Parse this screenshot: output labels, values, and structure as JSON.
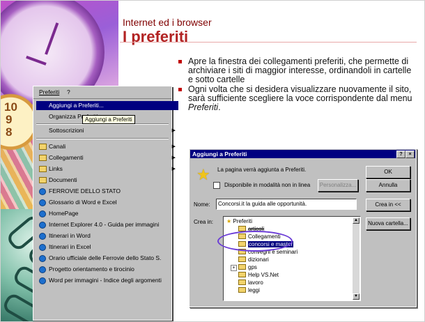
{
  "slide": {
    "subtitle": "Internet ed i browser",
    "title": "I preferiti",
    "bullets": [
      "Apre  la finestra dei collegamenti preferiti, che permette di archiviare i siti di maggior interesse, ordinandoli in cartelle e sotto cartelle",
      "Ogni volta che si desidera visualizzare nuovamente il sito, sarà sufficiente scegliere la voce corrispondente dal menu Preferiti."
    ],
    "accent_color": "#b22222"
  },
  "favorites_menu": {
    "menubar": [
      "Preferiti",
      "?"
    ],
    "tooltip": "Aggiungi a Preferiti",
    "items": [
      {
        "label": "Aggiungi a Preferiti...",
        "highlighted": true,
        "icon": "none"
      },
      {
        "label": "Organizza Preferiti...",
        "icon": "none"
      },
      {
        "label": "Sottoscrizioni",
        "submenu": true,
        "icon": "none"
      },
      {
        "label": "Canali",
        "submenu": true,
        "icon": "channel-folder-icon"
      },
      {
        "label": "Collegamenti",
        "submenu": true,
        "icon": "folder-icon"
      },
      {
        "label": "Links",
        "submenu": true,
        "icon": "folder-icon"
      },
      {
        "label": "Documenti",
        "icon": "folder-icon"
      },
      {
        "label": "FERROVIE DELLO STATO",
        "icon": "ie-page-icon"
      },
      {
        "label": "Glossario di Word e Excel",
        "icon": "ie-page-icon"
      },
      {
        "label": "HomePage",
        "icon": "ie-page-icon"
      },
      {
        "label": "Internet Explorer 4.0 - Guida per immagini",
        "icon": "ie-page-icon"
      },
      {
        "label": "Itinerari in Word",
        "icon": "ie-page-icon"
      },
      {
        "label": "Itinerari in Excel",
        "icon": "ie-page-icon"
      },
      {
        "label": "Orario ufficiale delle Ferrovie dello Stato S.",
        "icon": "ie-page-icon"
      },
      {
        "label": "Progetto orientamento e tirocinio",
        "icon": "ie-page-icon"
      },
      {
        "label": "Word per immagini - Indice degli argomenti",
        "icon": "ie-page-icon"
      }
    ]
  },
  "dialog": {
    "title": "Aggiungi a Preferiti",
    "title_buttons": [
      "?",
      "×"
    ],
    "message": "La pagina verrà aggiunta a Preferiti.",
    "offline_label": "Disponibile in modalità non in linea",
    "offline_checked": false,
    "customize_button": "Personalizza...",
    "ok_button": "OK",
    "cancel_button": "Annulla",
    "name_label": "Nome:",
    "name_value": "Concorsi.it la guida alle opportunità.",
    "create_in_button": "Crea in <<",
    "create_in_label": "Crea in:",
    "new_folder_button": "Nuova cartella...",
    "tree_root": "Preferiti",
    "tree_items": [
      {
        "label": "articoli",
        "state": "strike"
      },
      {
        "label": "Collegamenti",
        "state": "normal"
      },
      {
        "label": "concorsi e master",
        "state": "selected"
      },
      {
        "label": "convegni e seminari",
        "state": "normal"
      },
      {
        "label": "dizionari",
        "state": "normal"
      },
      {
        "label": "gps",
        "state": "normal"
      },
      {
        "label": "Help VS.Net",
        "state": "normal"
      },
      {
        "label": "lavoro",
        "state": "normal"
      },
      {
        "label": "leggi",
        "state": "normal"
      }
    ],
    "highlight_color": "#6a3bd6"
  }
}
